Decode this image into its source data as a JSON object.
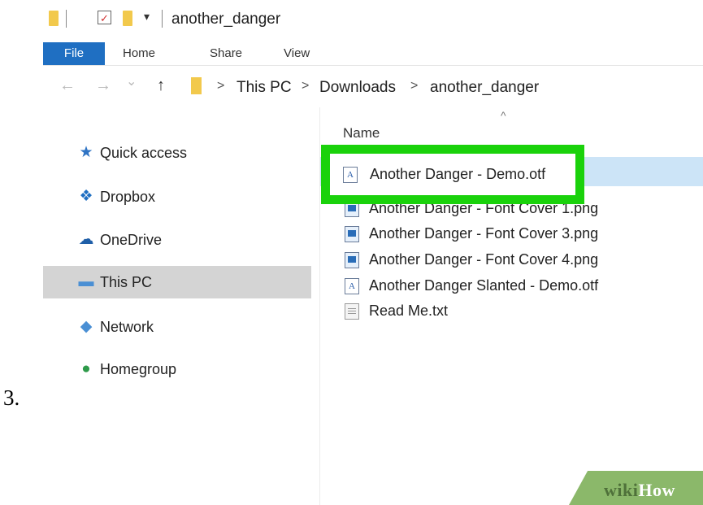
{
  "step_number": "3.",
  "window": {
    "title": "another_danger",
    "quick_access_toolbar": {
      "dropdown_glyph": "▾",
      "check_glyph": "✓"
    }
  },
  "ribbon": {
    "tabs": [
      {
        "label": "File",
        "active": true
      },
      {
        "label": "Home"
      },
      {
        "label": "Share"
      },
      {
        "label": "View"
      }
    ]
  },
  "address_bar": {
    "back_glyph": "←",
    "forward_glyph": "→",
    "recent_glyph": "⌄",
    "up_glyph": "↑",
    "separator_glyph": ">",
    "path": [
      "This PC",
      "Downloads",
      "another_danger"
    ]
  },
  "navigation_pane": {
    "items": [
      {
        "label": "Quick access",
        "icon": "star-icon",
        "glyph": "★",
        "color": "#2f74c4"
      },
      {
        "label": "Dropbox",
        "icon": "dropbox-icon",
        "glyph": "❖",
        "color": "#1f6fc2"
      },
      {
        "label": "OneDrive",
        "icon": "cloud-icon",
        "glyph": "☁",
        "color": "#1f5fa8"
      },
      {
        "label": "This PC",
        "icon": "computer-icon",
        "glyph": "▬",
        "color": "#4a8fd4",
        "selected": true
      },
      {
        "label": "Network",
        "icon": "network-icon",
        "glyph": "◆",
        "color": "#4a8fd4"
      },
      {
        "label": "Homegroup",
        "icon": "homegroup-icon",
        "glyph": "●",
        "color": "#2e9a4a"
      }
    ]
  },
  "file_list": {
    "sort_glyph": "^",
    "column_header": "Name",
    "files": [
      {
        "name": "Another Danger - Demo.otf",
        "type": "font",
        "selected": true,
        "highlighted": true
      },
      {
        "name": "Another Danger - Font Cover 1.png",
        "type": "image"
      },
      {
        "name": "Another Danger - Font Cover 3.png",
        "type": "image"
      },
      {
        "name": "Another Danger - Font Cover 4.png",
        "type": "image"
      },
      {
        "name": "Another Danger Slanted - Demo.otf",
        "type": "font"
      },
      {
        "name": "Read Me.txt",
        "type": "text"
      }
    ],
    "font_icon_glyph": "A"
  },
  "watermark": {
    "prefix": "wiki",
    "suffix": "How"
  },
  "colors": {
    "highlight": "#1ad20b",
    "file_tab": "#1f6fc2",
    "selected_row": "#cce4f7",
    "selected_nav": "#d4d4d4"
  }
}
